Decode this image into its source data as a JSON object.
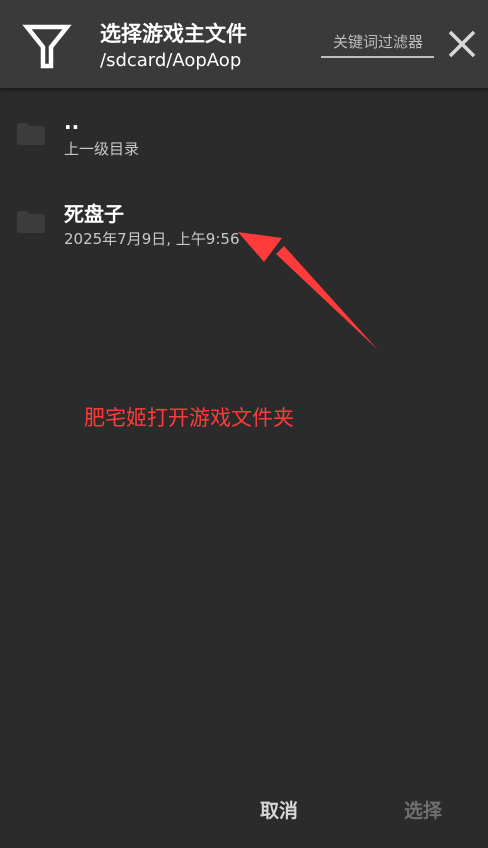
{
  "header": {
    "title": "选择游戏主文件",
    "path": "/sdcard/AopAop",
    "filter_placeholder": "关键词过滤器"
  },
  "items": [
    {
      "name": "..",
      "subtitle": "上一级目录"
    },
    {
      "name": "死盘子",
      "subtitle": "2025年7月9日, 上午9:56"
    }
  ],
  "annotation": {
    "text": "肥宅姬打开游戏文件夹",
    "color": "#ff3b3b"
  },
  "footer": {
    "cancel_label": "取消",
    "select_label": "选择"
  },
  "icons": {
    "filter": "filter-icon",
    "close": "close-icon",
    "folder": "folder-icon"
  }
}
